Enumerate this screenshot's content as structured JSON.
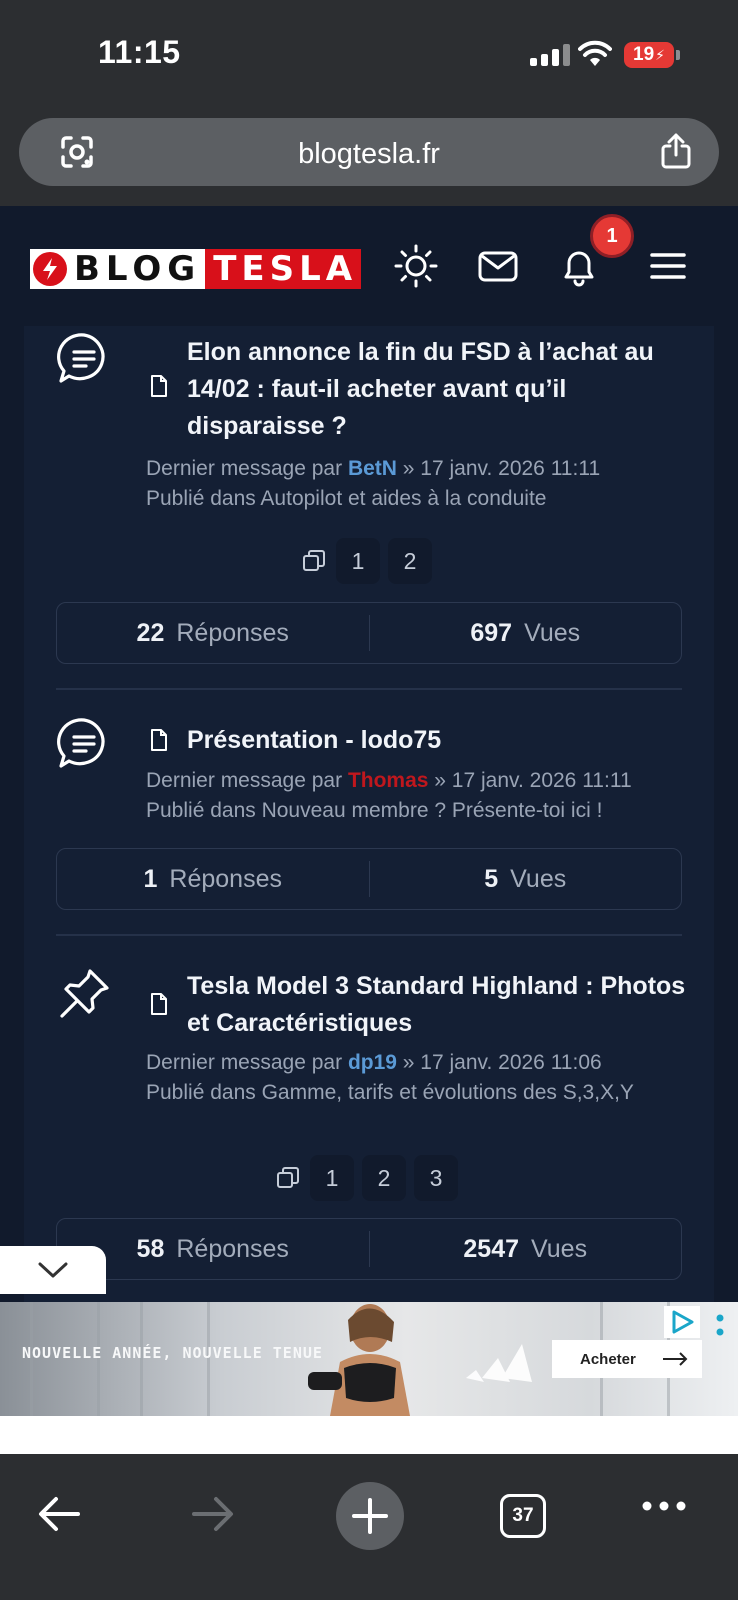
{
  "status_bar": {
    "time": "11:15",
    "battery": "19"
  },
  "browser": {
    "url": "blogtesla.fr",
    "tab_count": "37"
  },
  "site": {
    "logo_blog": "BLOG",
    "logo_tesla": "TESLA",
    "notification_count": "1"
  },
  "topics": [
    {
      "title": "Elon annonce la fin du FSD à l’achat au 14/02 : faut-il acheter avant qu’il disparaisse ?",
      "meta_prefix": "Dernier message par",
      "author": "BetN",
      "date": "» 17 janv. 2026 11:11",
      "published_in": "Publié dans Autopilot et aides à la conduite",
      "pages": [
        "1",
        "2"
      ],
      "replies": "22",
      "replies_label": "Réponses",
      "views": "697",
      "views_label": "Vues"
    },
    {
      "title": "Présentation - lodo75",
      "meta_prefix": "Dernier message par",
      "author": "Thomas",
      "date": "» 17 janv. 2026 11:11",
      "published_in": "Publié dans Nouveau membre ? Présente-toi ici !",
      "replies": "1",
      "replies_label": "Réponses",
      "views": "5",
      "views_label": "Vues"
    },
    {
      "title": "Tesla Model 3 Standard Highland : Photos et Caractéristiques",
      "meta_prefix": "Dernier message par",
      "author": "dp19",
      "date": "» 17 janv. 2026 11:06",
      "published_in": "Publié dans Gamme, tarifs et évolutions des S,3,X,Y",
      "pages": [
        "1",
        "2",
        "3"
      ],
      "replies": "58",
      "replies_label": "Réponses",
      "views": "2547",
      "views_label": "Vues"
    }
  ],
  "ad": {
    "tagline": "NOUVELLE ANNÉE, NOUVELLE TENUE",
    "cta": "Acheter"
  },
  "colors": {
    "accent_red": "#d8101a",
    "author_blue": "#5b9ad6",
    "author_red": "#c0171d",
    "panel_bg": "#141f34"
  }
}
